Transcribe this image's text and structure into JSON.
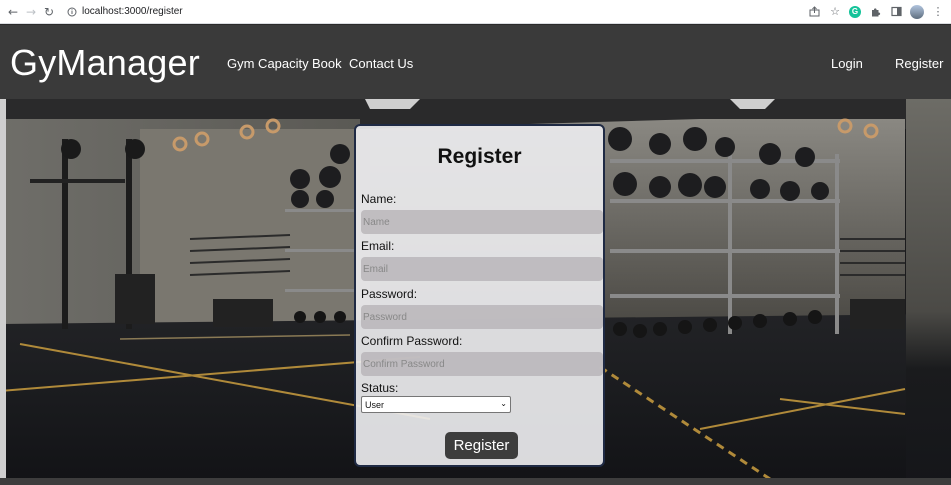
{
  "browser": {
    "url": "localhost:3000/register",
    "icons": [
      "back-arrow-icon",
      "forward-arrow-icon",
      "reload-icon",
      "info-icon",
      "share-icon",
      "star-icon",
      "grammarly-icon",
      "extensions-icon",
      "sidebar-icon",
      "profile-avatar",
      "menu-icon"
    ]
  },
  "header": {
    "brand": "GyManager",
    "nav": [
      "Gym Capacity",
      "Book",
      "Contact Us"
    ],
    "login": "Login",
    "register": "Register"
  },
  "form": {
    "title": "Register",
    "name_label": "Name:",
    "name_placeholder": "Name",
    "email_label": "Email:",
    "email_placeholder": "Email",
    "password_label": "Password:",
    "password_placeholder": "Password",
    "confirm_label": "Confirm Password:",
    "confirm_placeholder": "Confirm Password",
    "status_label": "Status:",
    "status_value": "User",
    "submit": "Register"
  },
  "colors": {
    "header_bg": "#3a3a3a",
    "card_border": "#1f2a44",
    "button_bg": "#3d3d3d"
  }
}
